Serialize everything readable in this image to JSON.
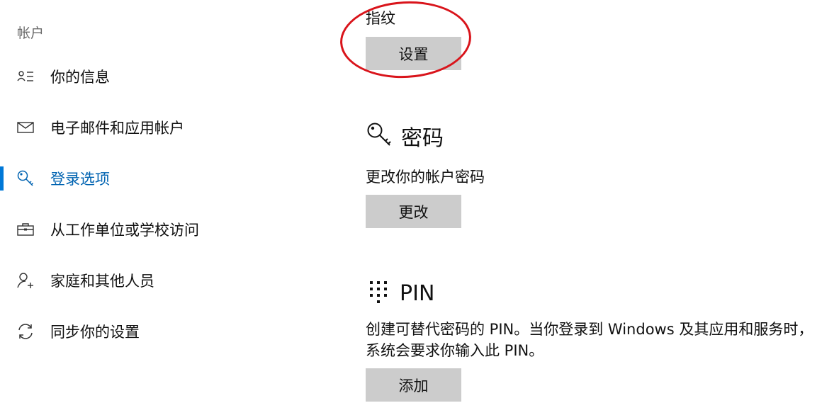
{
  "sidebar": {
    "title": "帐户",
    "items": [
      {
        "label": "你的信息",
        "icon": "person-list-icon"
      },
      {
        "label": "电子邮件和应用帐户",
        "icon": "mail-icon"
      },
      {
        "label": "登录选项",
        "icon": "key-icon",
        "active": true
      },
      {
        "label": "从工作单位或学校访问",
        "icon": "briefcase-icon"
      },
      {
        "label": "家庭和其他人员",
        "icon": "person-add-icon"
      },
      {
        "label": "同步你的设置",
        "icon": "sync-icon"
      }
    ]
  },
  "fingerprint": {
    "label": "指纹",
    "button": "设置"
  },
  "password": {
    "title": "密码",
    "icon": "key-icon",
    "description": "更改你的帐户密码",
    "button": "更改"
  },
  "pin": {
    "title": "PIN",
    "icon": "keypad-icon",
    "description_line1": "创建可替代密码的 PIN。当你登录到 Windows 及其应用和服务时，",
    "description_line2": "系统会要求你输入此 PIN。",
    "button": "添加"
  },
  "colors": {
    "accent": "#0078d7",
    "button_bg": "#cccccc",
    "annotation": "#d9141b"
  }
}
